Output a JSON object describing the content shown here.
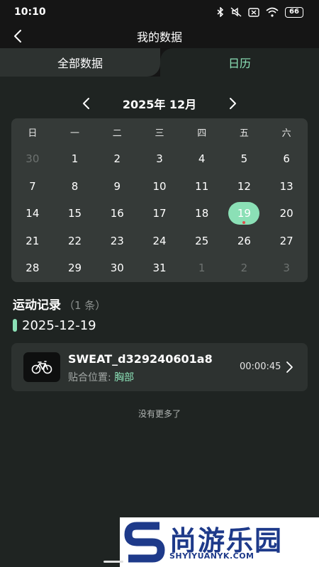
{
  "status_bar": {
    "time": "10:10",
    "battery": "66",
    "icons": [
      "bluetooth-icon",
      "mute-icon",
      "sim-icon",
      "wifi-icon",
      "battery-icon"
    ]
  },
  "header": {
    "title": "我的数据"
  },
  "tabs": [
    {
      "label": "全部数据",
      "active": false
    },
    {
      "label": "日历",
      "active": true
    }
  ],
  "calendar": {
    "month_label": "2025年 12月",
    "weekdays": [
      "日",
      "一",
      "二",
      "三",
      "四",
      "五",
      "六"
    ],
    "days": [
      {
        "d": "30",
        "muted": true
      },
      {
        "d": "1"
      },
      {
        "d": "2"
      },
      {
        "d": "3"
      },
      {
        "d": "4"
      },
      {
        "d": "5"
      },
      {
        "d": "6"
      },
      {
        "d": "7"
      },
      {
        "d": "8"
      },
      {
        "d": "9"
      },
      {
        "d": "10"
      },
      {
        "d": "11"
      },
      {
        "d": "12"
      },
      {
        "d": "13"
      },
      {
        "d": "14"
      },
      {
        "d": "15"
      },
      {
        "d": "16"
      },
      {
        "d": "17"
      },
      {
        "d": "18"
      },
      {
        "d": "19",
        "selected": true,
        "has_record": true
      },
      {
        "d": "20"
      },
      {
        "d": "21"
      },
      {
        "d": "22"
      },
      {
        "d": "23"
      },
      {
        "d": "24"
      },
      {
        "d": "25"
      },
      {
        "d": "26"
      },
      {
        "d": "27"
      },
      {
        "d": "28"
      },
      {
        "d": "29"
      },
      {
        "d": "30"
      },
      {
        "d": "31"
      },
      {
        "d": "1",
        "muted": true
      },
      {
        "d": "2",
        "muted": true
      },
      {
        "d": "3",
        "muted": true
      }
    ]
  },
  "records": {
    "title": "运动记录",
    "count": "（1 条）",
    "date": "2025-12-19",
    "items": [
      {
        "name": "SWEAT_d329240601a8",
        "position_label": "贴合位置:",
        "position_value": "胸部",
        "duration": "00:00:45",
        "icon": "bicycle-icon"
      }
    ],
    "end_text": "没有更多了"
  },
  "watermark": {
    "text": "尚游乐园",
    "url": "SHYIYUANYK.COM"
  },
  "colors": {
    "accent": "#8be0b6",
    "background": "#1f2422",
    "card": "#353a38",
    "dot": "#e04a4a"
  }
}
